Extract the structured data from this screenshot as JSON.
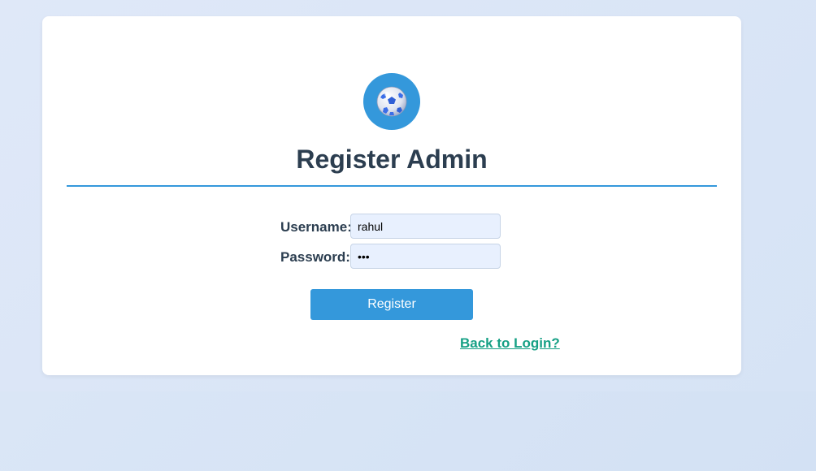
{
  "page": {
    "title": "Register Admin"
  },
  "logo": {
    "icon": "soccer-ball-icon",
    "accent_color": "#3498db"
  },
  "form": {
    "username_label": "Username:",
    "username_value": "rahul",
    "password_label": "Password:",
    "password_value": "abc"
  },
  "actions": {
    "register_label": "Register",
    "back_link_label": "Back to Login?"
  },
  "colors": {
    "accent": "#3498db",
    "title": "#2c3e50",
    "link": "#16a085"
  }
}
